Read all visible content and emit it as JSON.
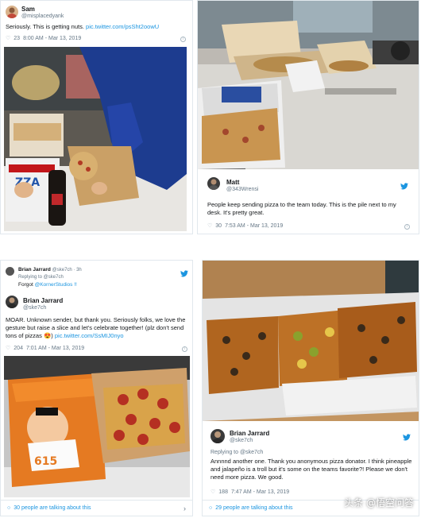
{
  "tweet1": {
    "name": "Sam",
    "handle": "@misplacedyank",
    "text": "Seriously. This is getting nuts.",
    "link": "pic.twitter.com/psSht2oowU",
    "likes": "23",
    "timestamp": "8:00 AM - Mar 13, 2019"
  },
  "tweet2": {
    "name": "Matt",
    "handle": "@343Wrensi",
    "text": "People keep sending pizza to the team today. This is the pile next to my desk. It's pretty great.",
    "likes": "30",
    "timestamp": "7:53 AM - Mar 13, 2019"
  },
  "tweet3": {
    "reply_name": "Brian Jarrard",
    "reply_handle": "@ske7ch · 3h",
    "replying_to": "Replying to @ske7ch",
    "reply_text": "Forgot",
    "reply_mention": "@KornerStudios !!",
    "name": "Brian Jarrard",
    "handle": "@ske7ch",
    "text": "MOAR. Unknown sender, but thank you. Seriously folks, we love the gesture but raise a slice and let's celebrate together! (plz don't send tons of pizzas 😍)",
    "link": "pic.twitter.com/SsMIJ0nyo",
    "likes": "204",
    "timestamp": "7:01 AM - Mar 13, 2019",
    "footer": "30 people are talking about this"
  },
  "tweet4": {
    "name": "Brian Jarrard",
    "handle": "@ske7ch",
    "replying_to": "Replying to @ske7ch",
    "text": "Annnnd another one. Thank you anonymous pizza donator. I think pineapple and jalapeño is a troll but it's some on the teams favorite?! Please we don't need more pizza. We good.",
    "likes": "188",
    "timestamp": "7:47 AM - Mar 13, 2019",
    "footer": "29 people are talking about this"
  },
  "watermark": "头条 @悟空问答",
  "colors": {
    "twitter_blue": "#1b95e0",
    "like_red": "#e0245e",
    "text_gray": "#657786"
  }
}
